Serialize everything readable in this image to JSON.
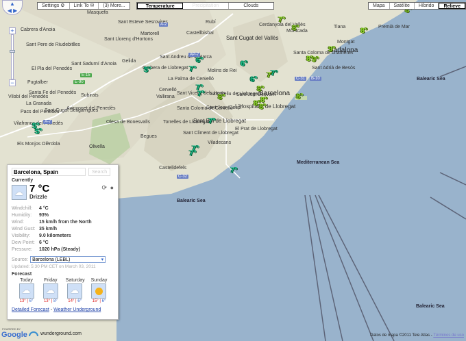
{
  "toolbar": {
    "settings": "Settings",
    "link_to": "Link To",
    "more": "(3) More...",
    "layers": [
      "Temperature",
      "Precipitation",
      "Clouds"
    ],
    "map_types": [
      "Mapa",
      "Satélite",
      "Híbrido",
      "Relieve"
    ]
  },
  "map": {
    "labels": [
      "Cabrera d'Anoia",
      "Sant Pere de Riudebitlles",
      "El Pla del Penedès",
      "Pugtalber",
      "Santa Fe del Penedès",
      "Vilobí del Penedès",
      "La Granada",
      "Pacs del Penedès",
      "Vilafranca del Penedès",
      "Sant Cugat Sesgarrigues",
      "Avinyonet del Penedès",
      "Els Monjos",
      "Olèrdola",
      "Olesa de Bonesvalls",
      "Olivella",
      "Sant Sadurní d'Anoia",
      "Subirats",
      "Gelida",
      "Sant Llorenç d'Hortons",
      "Sant Esteve Sesrovires",
      "Masquefa",
      "Martorell",
      "Castellbisbal",
      "Rubí",
      "Sant Cugat del Vallès",
      "Cerdanyola del Vallès",
      "Montcada",
      "Santa Coloma de Gramenet",
      "Sant Adrià de Besòs",
      "Badalona",
      "Montgat",
      "Tiana",
      "Premià de Mar",
      "Sant Andreu de la Barca",
      "Corbera de Llobregat",
      "Molins de Rei",
      "La Palma de Cervelló",
      "Cervelló",
      "Vallirana",
      "Sant Vicenç dels Horts",
      "Sant Feliu de Llobregat",
      "Sant Just Desvern",
      "Santa Coloma de Cervelló",
      "Sant Joan Despí",
      "Barcelona",
      "L'Hospitalet de Llobregat",
      "Torrelles de Llobregat",
      "Sant Boi de Llobregat",
      "Sant Climent de Llobregat",
      "El Prat de Llobregat",
      "Viladecans",
      "Begues",
      "Castelldefels"
    ],
    "seas": [
      "Mediterranean Sea",
      "Balearic Sea",
      "Balearic Sea",
      "Balearic Sea"
    ],
    "roads": [
      "AP-7",
      "A-2",
      "E-15",
      "E-90",
      "C-31",
      "B-10",
      "C-32",
      "A-7"
    ],
    "stations": [
      "5°",
      "5°",
      "5°",
      "6°",
      "7°",
      "6°",
      "6°",
      "7°",
      "7°",
      "8°",
      "7°",
      "7°",
      "8°",
      "8°",
      "8°",
      "8°",
      "8°",
      "7°",
      "7°",
      "7°",
      "7°",
      "7°",
      "8°",
      "8°",
      "9°",
      "9°",
      "8°",
      "8°"
    ]
  },
  "panel": {
    "location": "Barcelona, Spain",
    "search": "Search",
    "currently": "Currently",
    "temp": "7 °C",
    "condition": "Drizzle",
    "details": [
      {
        "k": "Windchill:",
        "v": "4 °C"
      },
      {
        "k": "Humidity:",
        "v": "93%"
      },
      {
        "k": "Wind:",
        "v": "15 km/h from the North"
      },
      {
        "k": "Wind Gust:",
        "v": "35 km/h"
      },
      {
        "k": "Visibility:",
        "v": "9.0 kilometers"
      },
      {
        "k": "Dew Point:",
        "v": "6 °C"
      },
      {
        "k": "Pressure:",
        "v": "1020 hPa (Steady)"
      }
    ],
    "source_label": "Source:",
    "source": "Barcelona (LEBL)",
    "updated": "Updated: 5:30 PM CET on March 03, 2011",
    "forecast": "Forecast",
    "days": [
      {
        "d": "Today",
        "hi": "13°",
        "lo": "6°",
        "icon": "rain"
      },
      {
        "d": "Friday",
        "hi": "13°",
        "lo": "8°",
        "icon": "rain"
      },
      {
        "d": "Saturday",
        "hi": "14°",
        "lo": "6°",
        "icon": "rain"
      },
      {
        "d": "Sunday",
        "hi": "15°",
        "lo": "6°",
        "icon": "sun"
      }
    ],
    "detailed": "Detailed Forecast",
    "sep": " - ",
    "wu": "Weather Underground"
  },
  "footer": {
    "powered": "POWERED BY",
    "google": "Google",
    "wu_logo": "wunderground.com",
    "copyright": "Datos de mapa ©2011 Tele Atlas -",
    "terms": "Términos de uso"
  }
}
